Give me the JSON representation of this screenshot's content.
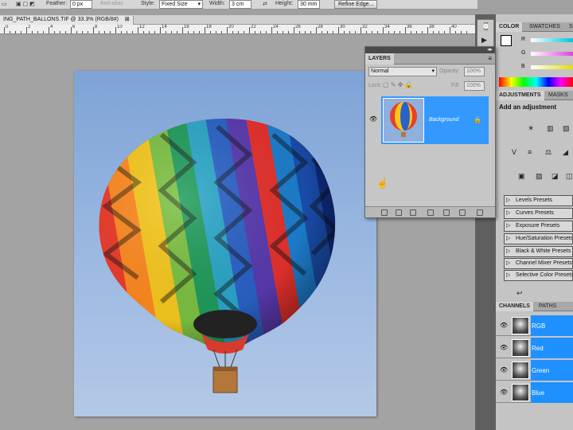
{
  "options_bar": {
    "feather_label": "Feather:",
    "feather_value": "0 px",
    "antialias_label": "Anti-alias",
    "style_label": "Style:",
    "style_value": "Fixed Size",
    "width_label": "Width:",
    "width_value": "3 cm",
    "height_label": "Height:",
    "height_value": "30 mm",
    "refine_edge": "Refine Edge..."
  },
  "document": {
    "tab_title": "ING_PATH_BALLONS.TIF @ 33.3% (RGB/8#)",
    "close": "⊠",
    "ruler_numbers": [
      "0",
      "2",
      "4",
      "6",
      "8",
      "10",
      "12",
      "14",
      "16",
      "18",
      "20",
      "22",
      "24",
      "26",
      "28",
      "30",
      "32",
      "34",
      "36",
      "38",
      "40"
    ]
  },
  "color_panel": {
    "tabs": [
      "COLOR",
      "SWATCHES",
      "S"
    ],
    "channels": [
      {
        "label": "R",
        "color": "#00b7d6"
      },
      {
        "label": "G",
        "color": "#d63fd6"
      },
      {
        "label": "B",
        "color": "#d6d600"
      }
    ]
  },
  "adjustments_panel": {
    "tabs": [
      "ADJUSTMENTS",
      "MASKS"
    ],
    "heading": "Add an adjustment",
    "presets": [
      "Levels Presets",
      "Curves Presets",
      "Exposure Presets",
      "Hue/Saturation Presets",
      "Black & White Presets",
      "Channel Mixer Presets",
      "Selective Color Presets"
    ]
  },
  "channels_panel": {
    "tabs": [
      "CHANNELS",
      "PATHS"
    ],
    "rows": [
      "RGB",
      "Red",
      "Green",
      "Blue"
    ]
  },
  "layers_panel": {
    "tab": "LAYERS",
    "blend_mode": "Normal",
    "opacity_label": "Opacity:",
    "opacity_value": "100%",
    "lock_label": "Lock:",
    "fill_label": "Fill:",
    "fill_value": "100%",
    "layer_name": "Background"
  },
  "colors": {
    "accent": "#3399ff",
    "selection": "#1e90ff"
  }
}
